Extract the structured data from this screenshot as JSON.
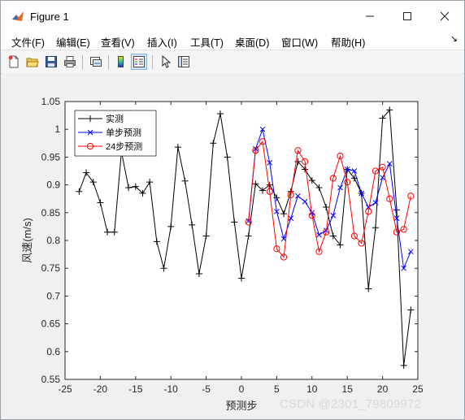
{
  "window": {
    "title": "Figure 1"
  },
  "menu": {
    "items": [
      "文件(F)",
      "编辑(E)",
      "查看(V)",
      "插入(I)",
      "工具(T)",
      "桌面(D)",
      "窗口(W)",
      "帮助(H)"
    ]
  },
  "toolbar": {
    "icons": [
      "new-figure-icon",
      "open-file-icon",
      "save-icon",
      "print-icon",
      "link-plot-icon",
      "insert-colorbar-icon",
      "insert-legend-icon",
      "pointer-icon",
      "property-editor-icon"
    ]
  },
  "watermark": "CSDN @2301_79809972",
  "chart_data": {
    "type": "line",
    "xlabel": "预测步",
    "ylabel": "风速(m/s)",
    "xlim": [
      -25,
      25
    ],
    "ylim": [
      0.55,
      1.05
    ],
    "xticks": [
      "-25",
      "-20",
      "-15",
      "-10",
      "-5",
      "0",
      "5",
      "10",
      "15",
      "20",
      "25"
    ],
    "yticks": [
      "0.55",
      "0.6",
      "0.65",
      "0.7",
      "0.75",
      "0.8",
      "0.85",
      "0.9",
      "0.95",
      "1",
      "1.05"
    ],
    "grid": false,
    "legend_position": "top-left",
    "series": [
      {
        "name": "实测",
        "color": "#000000",
        "marker": "plus",
        "x": [
          -23,
          -22,
          -21,
          -20,
          -19,
          -18,
          -17,
          -16,
          -15,
          -14,
          -13,
          -12,
          -11,
          -10,
          -9,
          -8,
          -7,
          -6,
          -5,
          -4,
          -3,
          -2,
          -1,
          0,
          1,
          2,
          3,
          4,
          5,
          6,
          7,
          8,
          9,
          10,
          11,
          12,
          13,
          14,
          15,
          16,
          17,
          18,
          19,
          20,
          21,
          22,
          23,
          24
        ],
        "y": [
          0.888,
          0.922,
          0.905,
          0.868,
          0.815,
          0.815,
          0.96,
          0.895,
          0.897,
          0.885,
          0.905,
          0.798,
          0.75,
          0.825,
          0.968,
          0.907,
          0.828,
          0.74,
          0.808,
          0.975,
          1.028,
          0.95,
          0.833,
          0.732,
          0.808,
          0.902,
          0.89,
          0.9,
          0.877,
          0.848,
          0.888,
          0.942,
          0.928,
          0.908,
          0.895,
          0.86,
          0.808,
          0.792,
          0.928,
          0.912,
          0.885,
          0.713,
          0.823,
          1.02,
          1.035,
          0.855,
          0.575,
          0.675
        ]
      },
      {
        "name": "单步预测",
        "color": "#0000ff",
        "marker": "x",
        "x": [
          1,
          2,
          3,
          4,
          5,
          6,
          7,
          8,
          9,
          10,
          11,
          12,
          13,
          14,
          15,
          16,
          17,
          18,
          19,
          20,
          21,
          22,
          23,
          24
        ],
        "y": [
          0.835,
          0.965,
          1.0,
          0.94,
          0.852,
          0.803,
          0.84,
          0.88,
          0.87,
          0.85,
          0.81,
          0.818,
          0.845,
          0.895,
          0.928,
          0.925,
          0.885,
          0.86,
          0.868,
          0.913,
          0.938,
          0.84,
          0.75,
          0.78
        ]
      },
      {
        "name": "24步预测",
        "color": "#ff0000",
        "marker": "circle",
        "x": [
          1,
          2,
          3,
          4,
          5,
          6,
          7,
          8,
          9,
          10,
          11,
          12,
          13,
          14,
          15,
          16,
          17,
          18,
          19,
          20,
          21,
          22,
          23,
          24
        ],
        "y": [
          0.833,
          0.962,
          0.978,
          0.888,
          0.785,
          0.77,
          0.882,
          0.962,
          0.942,
          0.845,
          0.78,
          0.815,
          0.912,
          0.952,
          0.905,
          0.808,
          0.795,
          0.852,
          0.925,
          0.932,
          0.875,
          0.815,
          0.82,
          0.88
        ]
      }
    ]
  }
}
